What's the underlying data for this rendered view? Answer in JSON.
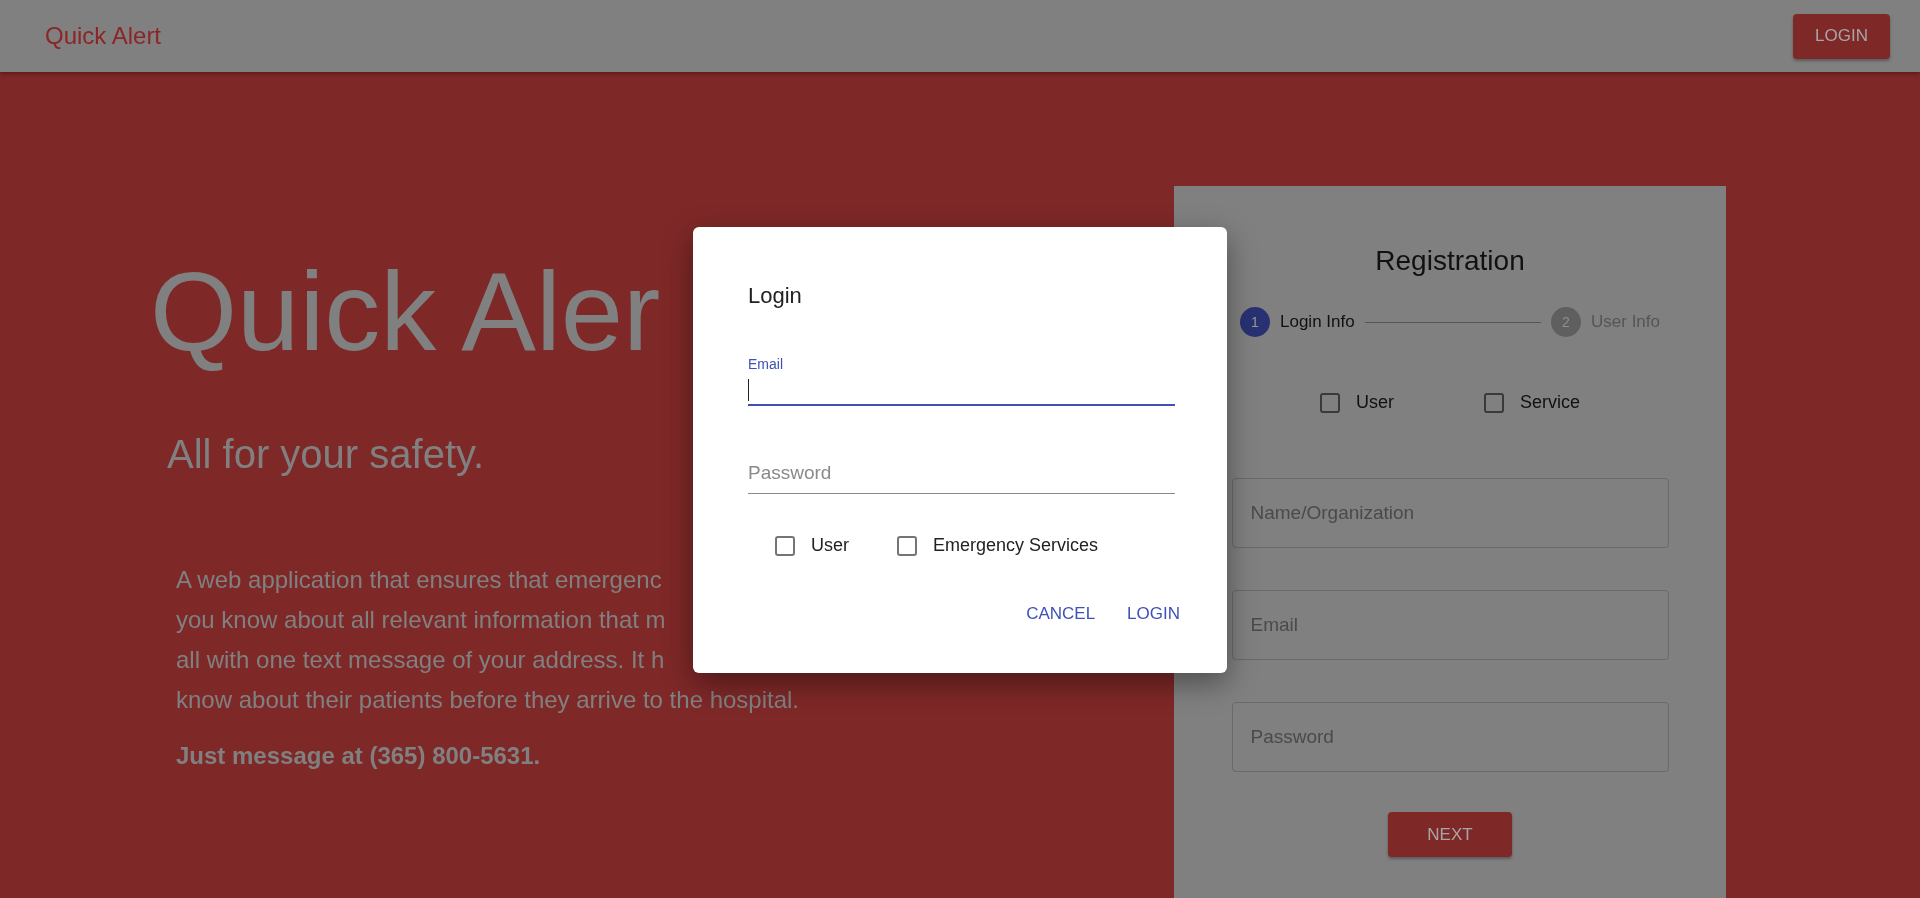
{
  "header": {
    "title": "Quick Alert",
    "login_button": "LOGIN"
  },
  "hero": {
    "title": "Quick Aler",
    "subtitle": "All for your safety.",
    "description_lines": [
      "A web application that ensures that emergenc",
      "you know about all relevant information that m",
      "all with one text message of your address. It h",
      "know about their patients before they arrive to the hospital."
    ],
    "contact": "Just message at (365) 800-5631."
  },
  "registration": {
    "title": "Registration",
    "steps": [
      {
        "number": "1",
        "label": "Login Info",
        "selected": true
      },
      {
        "number": "2",
        "label": "User Info",
        "selected": false
      }
    ],
    "account_types": [
      {
        "label": "User",
        "checked": false
      },
      {
        "label": "Service",
        "checked": false
      }
    ],
    "fields": [
      {
        "placeholder": "Name/Organization"
      },
      {
        "placeholder": "Email"
      },
      {
        "placeholder": "Password"
      }
    ],
    "next_button": "NEXT"
  },
  "login_dialog": {
    "title": "Login",
    "fields": [
      {
        "label": "Email",
        "focused": true
      },
      {
        "label": "Password",
        "focused": false
      }
    ],
    "roles": [
      {
        "label": "User",
        "checked": false
      },
      {
        "label": "Emergency Services",
        "checked": false
      }
    ],
    "buttons": [
      "CANCEL",
      "LOGIN"
    ]
  }
}
